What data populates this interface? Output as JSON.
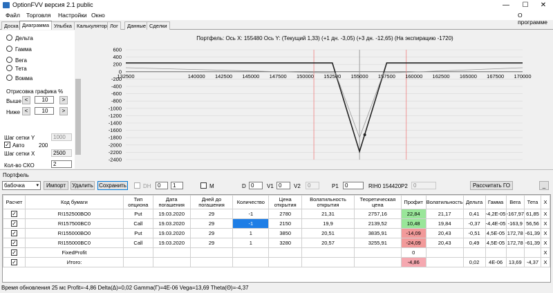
{
  "window": {
    "title": "OptionFVV версия 2.1 public",
    "minimize": "—",
    "maximize": "☐",
    "close": "✕"
  },
  "menu": {
    "items": [
      "Файл",
      "Торговля",
      "Настройки",
      "Окно"
    ],
    "about": "О программе"
  },
  "tabs": [
    "Доска",
    "Диаграмма",
    "Улыбка",
    "Калькулятор",
    "Лог",
    "Данные",
    "Сделки"
  ],
  "active_tab": "Диаграмма",
  "left_panel": {
    "radios": [
      "Дельта",
      "Гамма",
      "Вега",
      "Тета",
      "Вомма"
    ],
    "draw_label": "Отрисовка графика %",
    "above_label": "Выше",
    "above_value": "10",
    "below_label": "Ниже",
    "below_value": "10",
    "dec": "<",
    "inc": ">",
    "grid_y_label": "Шаг сетки Y",
    "grid_y_value": "1000",
    "auto_label": "Авто",
    "auto_value": "200",
    "grid_x_label": "Шаг сетки X",
    "grid_x_value": "2500",
    "sko_label": "Кол-во СКО",
    "sko_value": "2"
  },
  "chart_data": {
    "type": "line",
    "title": "Портфель: Ось X: 155480 Ось Y:  (Текущий 1,33)  (+1 дн. -3,05)  (+3 дн. -12,65)  (На экспирацию -1720)",
    "x_ticks": [
      "132500",
      "140000",
      "142500",
      "145000",
      "147500",
      "150000",
      "152500",
      "155000",
      "157500",
      "160000",
      "162500",
      "165000",
      "167500",
      "170000"
    ],
    "y_ticks": [
      "600",
      "400",
      "200",
      "0",
      "-200",
      "-400",
      "-600",
      "-800",
      "-1000",
      "-1200",
      "-1400",
      "-1600",
      "-1800",
      "-2000",
      "-2200",
      "-2400"
    ],
    "xlim": [
      133500,
      170000
    ],
    "ylim": [
      -2400,
      600
    ],
    "series": [
      {
        "points": [
          [
            133500,
            240
          ],
          [
            152500,
            240
          ],
          [
            155000,
            -2180
          ],
          [
            157500,
            240
          ],
          [
            170000,
            240
          ]
        ]
      },
      {
        "points": [
          [
            133500,
            110
          ],
          [
            152800,
            -40
          ],
          [
            155000,
            -1800
          ],
          [
            157200,
            -40
          ],
          [
            170000,
            110
          ]
        ]
      }
    ],
    "red_lines": [
      150800,
      159300
    ],
    "center_line": 155000,
    "marker": [
      155480,
      -1720
    ]
  },
  "portfolio": {
    "label": "Портфель",
    "select_value": "бабочка",
    "import": "Импорт",
    "delete": "Удалить",
    "save": "Сохранить",
    "dh_label": "DH",
    "spin1": "0",
    "spin2": "1",
    "m_label": "M",
    "d_label": "D",
    "d_value": "0",
    "v1_label": "V1",
    "v1_value": "0",
    "v2_label": "V2",
    "v2_value": "0",
    "p1_label": "P1",
    "p1_value": "0",
    "rih_label": "RIH0 154420",
    "p2_label": "P2",
    "p2_value": "0",
    "calc_go": "Рассчитать ГО",
    "min_btn": "_"
  },
  "table": {
    "headers": [
      "Расчет",
      "Код бумаги",
      "Тип опциона",
      "Дата погашения",
      "Дней до погашения",
      "Количество",
      "Цена открытия",
      "Волатильность открытия",
      "Теоретическая цена",
      "Профит",
      "Волатильность",
      "Дельта",
      "Гамма",
      "Вега",
      "Тета",
      "X"
    ],
    "rows": [
      [
        "RI152500BO0",
        "Put",
        "19.03.2020",
        "29",
        "-1",
        "2780",
        "21,31",
        "2757,16",
        "22,84",
        "21,17",
        "0,41",
        "-4,2E-05",
        "-167,97",
        "61,85",
        "X"
      ],
      [
        "RI157500BC0",
        "Call",
        "19.03.2020",
        "29",
        "-1",
        "2150",
        "19,9",
        "2139,52",
        "10,48",
        "19,84",
        "-0,37",
        "-4,4E-05",
        "-163,9",
        "56,56",
        "X"
      ],
      [
        "RI155000BO0",
        "Put",
        "19.03.2020",
        "29",
        "1",
        "3850",
        "20,51",
        "3835,91",
        "-14,09",
        "20,43",
        "-0,51",
        "4,5E-05",
        "172,78",
        "-61,39",
        "X"
      ],
      [
        "RI155000BC0",
        "Call",
        "19.03.2020",
        "29",
        "1",
        "3280",
        "20,57",
        "3255,91",
        "-24,09",
        "20,43",
        "0,49",
        "4,5E-05",
        "172,78",
        "-61,39",
        "X"
      ]
    ],
    "fixed_label": "FixedProfit",
    "fixed_value": "0",
    "total_label": "Итого:",
    "total": {
      "profit": "-4,86",
      "delta": "0,02",
      "gamma": "4E-06",
      "vega": "13,69",
      "theta": "-4,37"
    },
    "x": "X"
  },
  "status": "Время обновления 25 мс  Profit=-4,86 Delta(Δ)=0,02 Gamma(Γ)=4E-06 Vega=13,69 Theta(Θ)=-4,37"
}
